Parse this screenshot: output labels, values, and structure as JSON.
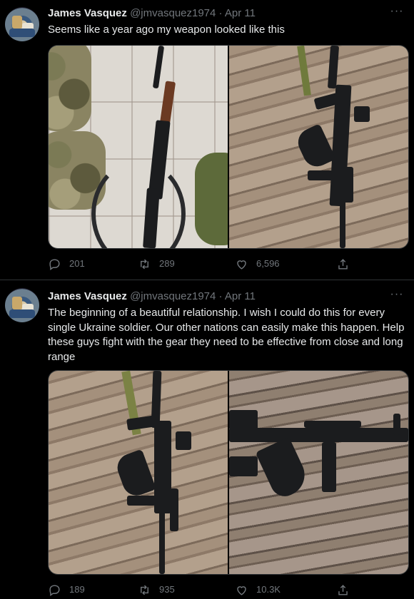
{
  "tweets": [
    {
      "author": "James Vasquez",
      "meta": "@jmvasquez1974 · Apr 11",
      "text": "Seems like a year ago my weapon looked like this",
      "replies": "201",
      "retweets": "289",
      "likes": "6,596",
      "icons": [
        "more-icon",
        "reply-icon",
        "retweet-icon",
        "like-icon",
        "share-icon"
      ]
    },
    {
      "author": "James Vasquez",
      "meta": "@jmvasquez1974 · Apr 11",
      "text": "The beginning of a beautiful relationship. I wish I could do this for every single Ukraine soldier. Our other nations can easily make this happen. Help these guys fight with the gear they need to be effective from close and long range",
      "replies": "189",
      "retweets": "935",
      "likes": "10.3K",
      "icons": [
        "more-icon",
        "reply-icon",
        "retweet-icon",
        "like-icon",
        "share-icon"
      ]
    }
  ],
  "colors": {
    "background": "#000000",
    "text": "#e7e9ea",
    "secondary": "#71767b",
    "divider": "#2f3336"
  }
}
